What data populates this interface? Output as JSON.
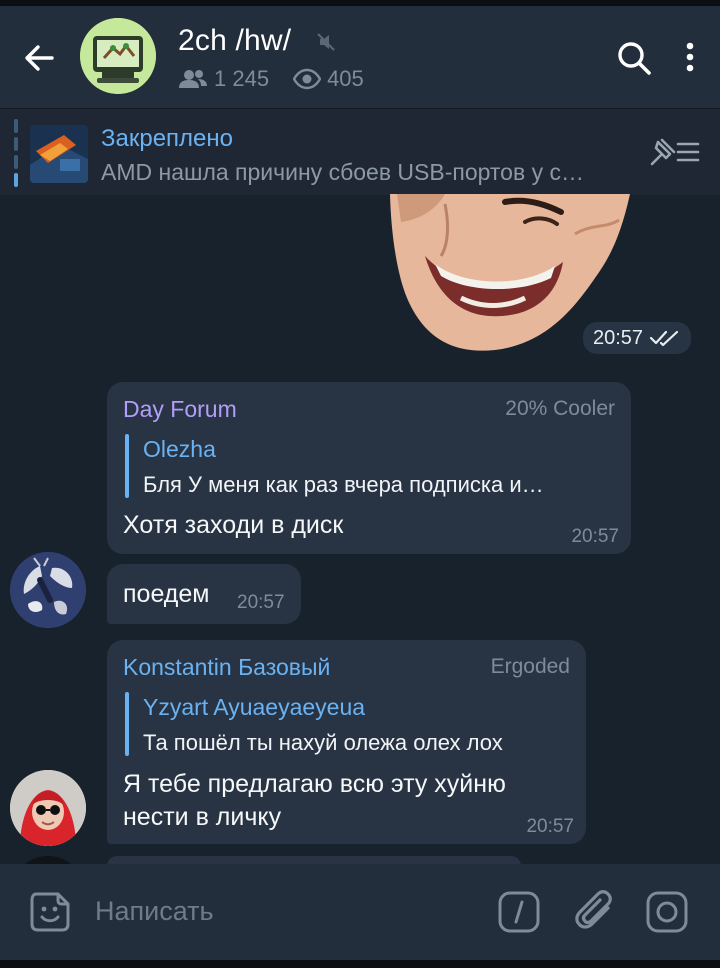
{
  "header": {
    "title": "2ch /hw/",
    "members": "1 245",
    "views": "405"
  },
  "pinned": {
    "title": "Закреплено",
    "text": "AMD нашла причину сбоев USB-портов у с…"
  },
  "sticker": {
    "time": "20:57"
  },
  "messages": [
    {
      "sender": "Day Forum",
      "sender_color": "#b39dfa",
      "rank": "20% Cooler",
      "reply_name": "Olezha",
      "reply_text": "Бля У меня как раз вчера подписка и…",
      "text": "Хотя заходи в диск",
      "time": "20:57"
    },
    {
      "text": "поедем",
      "time": "20:57"
    },
    {
      "sender": "Konstantin Базовый",
      "sender_color": "#6ab2f2",
      "rank": "Ergoded",
      "reply_name": "Yzyart Ayuaeyaeyeua",
      "reply_text": "Та пошёл ты нахуй олежа олех лох",
      "text_line1": "Я тебе предлагаю всю эту хуйню",
      "text_line2": "нести в личку",
      "time": "20:57"
    }
  ],
  "composer": {
    "placeholder": "Написать"
  },
  "colors": {
    "background": "#18222d",
    "header": "#232e3c",
    "bubble": "#283443",
    "accent": "#6ab2f2"
  }
}
